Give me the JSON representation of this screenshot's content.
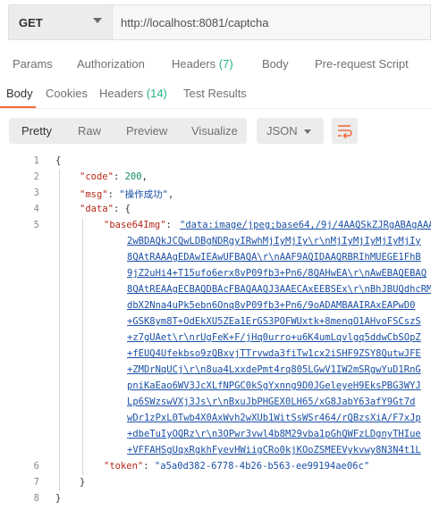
{
  "request": {
    "method": "GET",
    "url": "http://localhost:8081/captcha"
  },
  "request_tabs": {
    "params": "Params",
    "authorization": "Authorization",
    "headers": "Headers",
    "headers_count": "(7)",
    "body": "Body",
    "prerequest": "Pre-request Script"
  },
  "response_tabs": {
    "body": "Body",
    "cookies": "Cookies",
    "headers": "Headers",
    "headers_count": "(14)",
    "test_results": "Test Results"
  },
  "toolbar": {
    "pretty": "Pretty",
    "raw": "Raw",
    "preview": "Preview",
    "visualize": "Visualize",
    "format": "JSON"
  },
  "colors": {
    "accent": "#f26b3a",
    "key": "#b22818",
    "string": "#1a4fa6",
    "number": "#0f8a63",
    "badge": "#26b47f"
  },
  "icons": {
    "method_dropdown": "chevron-down-icon",
    "format_dropdown": "chevron-down-icon",
    "wrap": "wrap-lines-icon"
  },
  "code": {
    "line_numbers": [
      "1",
      "2",
      "3",
      "4",
      "5",
      "6",
      "7",
      "8"
    ],
    "open_brace": "{",
    "close_brace": "}",
    "code_key": "\"code\"",
    "code_value": "200",
    "msg_key": "\"msg\"",
    "msg_value": "\"操作成功\"",
    "data_key": "\"data\"",
    "data_open": "{",
    "data_close": "}",
    "base64_key": "\"base64Img\"",
    "base64_lines": [
      "\"data:image/jpeg;base64,/9j/4AAQSkZJRgABAgAAAQ",
      "2wBDAQkJCQwLDBgNDRgyIRwhMjIyMjIy\\r\\nMjIyMjIyMjIyMjIy",
      "8QAtRAAAgEDAwIEAwUFBAQA\\r\\nAAF9AQIDAAQRBRIhMUEGE1FhB",
      "9jZ2uHi4+T15ufo6erx8vP09fb3+Pn6/8QAHwEA\\r\\nAwEBAQEBAQ",
      "8QAtREAAgECBAQDBAcFBAQAAQJ3AAECAxEEBSEx\\r\\nBhJBUQdhcRM",
      "dbX2Nna4uPk5ebn6Onq8vP09fb3+Pn6/9oADAMBAAIRAxEAPwD0",
      "+GSK8ym8T+OdEkXU5ZEa1ErGS3POFWUxtk+8menqO1AHvoFSCszS",
      "+z7gUAet\\r\\nrUgFeK+F/jHq0urro+u6K4umLqvlgq5ddwCbSOpZ",
      "+fEUQ4Ufekbso9zQBxvjTTrvwda3fiTw1cx2iSHF9ZSY8QutwJFE",
      "+ZMDrNqUCj\\r\\n8ua4LxxdePmt4rq805LGwV1IW2mSRgwYuD1RnG",
      "pniKaEao6WV3JcXLfNPGC0kSgYxnng9D0JGeleyeH9EksPBG3WYJ",
      "Lp6SWzswVXj3Js\\r\\nBxuJbPHGEX0LH65/xG8JabY63afY9Gt7d",
      "wDr1zPxL0Twb4X0AxWvh2wXUb1WitSsWSr464/rQBzsXiA/F7xJp",
      "+dbeTuIyOQRz\\r\\n3OPwr3vwl4b8M29vba1pGhQWFzLDgnyTHIue",
      "+VFFAHSgUqxRgkhFyevHWiigCRo0kjKOoZSMEEVykvwy8N3N4t1L"
    ],
    "token_key": "\"token\"",
    "token_value": "\"a5a0d382-6778-4b26-b563-ee99194ae06c\""
  }
}
